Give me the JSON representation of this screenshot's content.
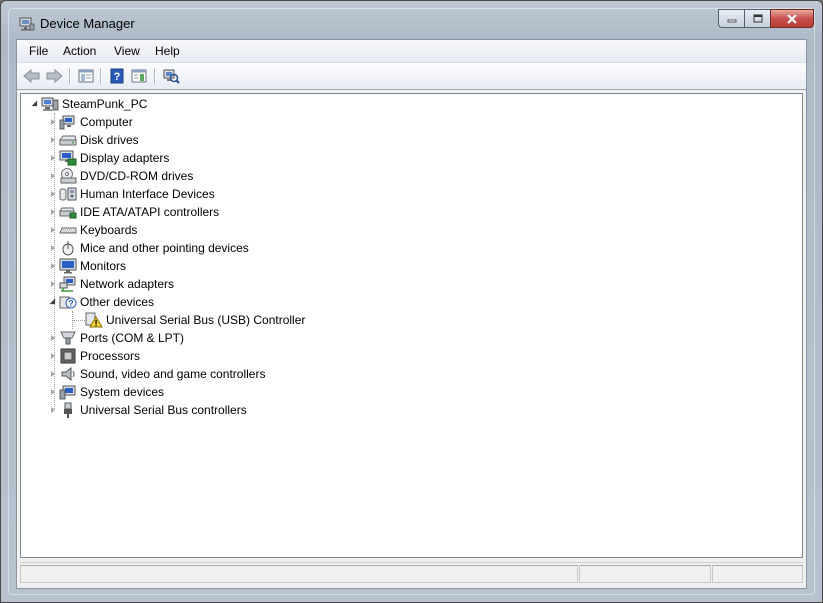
{
  "window": {
    "title": "Device Manager",
    "icon": "device-manager-icon"
  },
  "menubar": {
    "items": [
      "File",
      "Action",
      "View",
      "Help"
    ]
  },
  "toolbar": {
    "buttons": [
      "back-arrow-icon",
      "forward-arrow-icon",
      "show-hide-console-tree-icon",
      "help-icon",
      "properties-icon",
      "scan-hardware-icon"
    ]
  },
  "tree": {
    "root": {
      "label": "SteamPunk_PC",
      "icon": "computer-root-icon",
      "expanded": true
    },
    "items": [
      {
        "label": "Computer",
        "icon": "computer-icon",
        "expanded": false
      },
      {
        "label": "Disk drives",
        "icon": "disk-drive-icon",
        "expanded": false
      },
      {
        "label": "Display adapters",
        "icon": "display-adapter-icon",
        "expanded": false
      },
      {
        "label": "DVD/CD-ROM drives",
        "icon": "dvd-drive-icon",
        "expanded": false
      },
      {
        "label": "Human Interface Devices",
        "icon": "hid-icon",
        "expanded": false
      },
      {
        "label": "IDE ATA/ATAPI controllers",
        "icon": "ide-controller-icon",
        "expanded": false
      },
      {
        "label": "Keyboards",
        "icon": "keyboard-icon",
        "expanded": false
      },
      {
        "label": "Mice and other pointing devices",
        "icon": "mouse-icon",
        "expanded": false
      },
      {
        "label": "Monitors",
        "icon": "monitor-icon",
        "expanded": false
      },
      {
        "label": "Network adapters",
        "icon": "network-adapter-icon",
        "expanded": false
      },
      {
        "label": "Other devices",
        "icon": "unknown-device-icon",
        "expanded": true,
        "children": [
          {
            "label": "Universal Serial Bus (USB) Controller",
            "icon": "warning-device-icon"
          }
        ]
      },
      {
        "label": "Ports (COM & LPT)",
        "icon": "port-icon",
        "expanded": false
      },
      {
        "label": "Processors",
        "icon": "processor-icon",
        "expanded": false
      },
      {
        "label": "Sound, video and game controllers",
        "icon": "speaker-icon",
        "expanded": false
      },
      {
        "label": "System devices",
        "icon": "system-device-icon",
        "expanded": false
      },
      {
        "label": "Universal Serial Bus controllers",
        "icon": "usb-icon",
        "expanded": false
      }
    ]
  },
  "statusbar": {
    "panes": [
      "",
      "",
      ""
    ]
  },
  "colors": {
    "caption_close": "#c75050",
    "window_frame": "#aeb9c7",
    "tree_bg": "#ffffff",
    "help_icon_blue": "#2a5ab8"
  }
}
